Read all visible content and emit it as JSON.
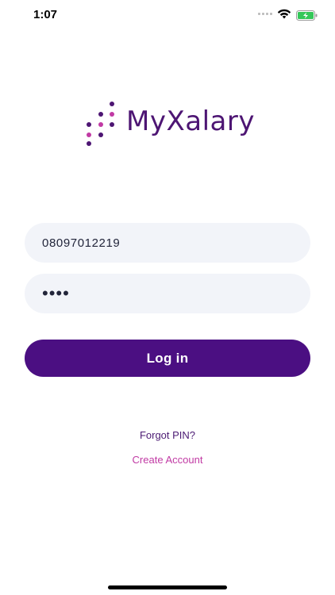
{
  "status_bar": {
    "time": "1:07"
  },
  "brand": {
    "name": "MyXalary",
    "primary_color": "#4b0f82",
    "accent_color": "#c13aa4"
  },
  "login": {
    "phone_value": "08097012219",
    "pin_value": "••••",
    "login_label": "Log in",
    "forgot_label": "Forgot PIN?",
    "create_label": "Create Account"
  }
}
